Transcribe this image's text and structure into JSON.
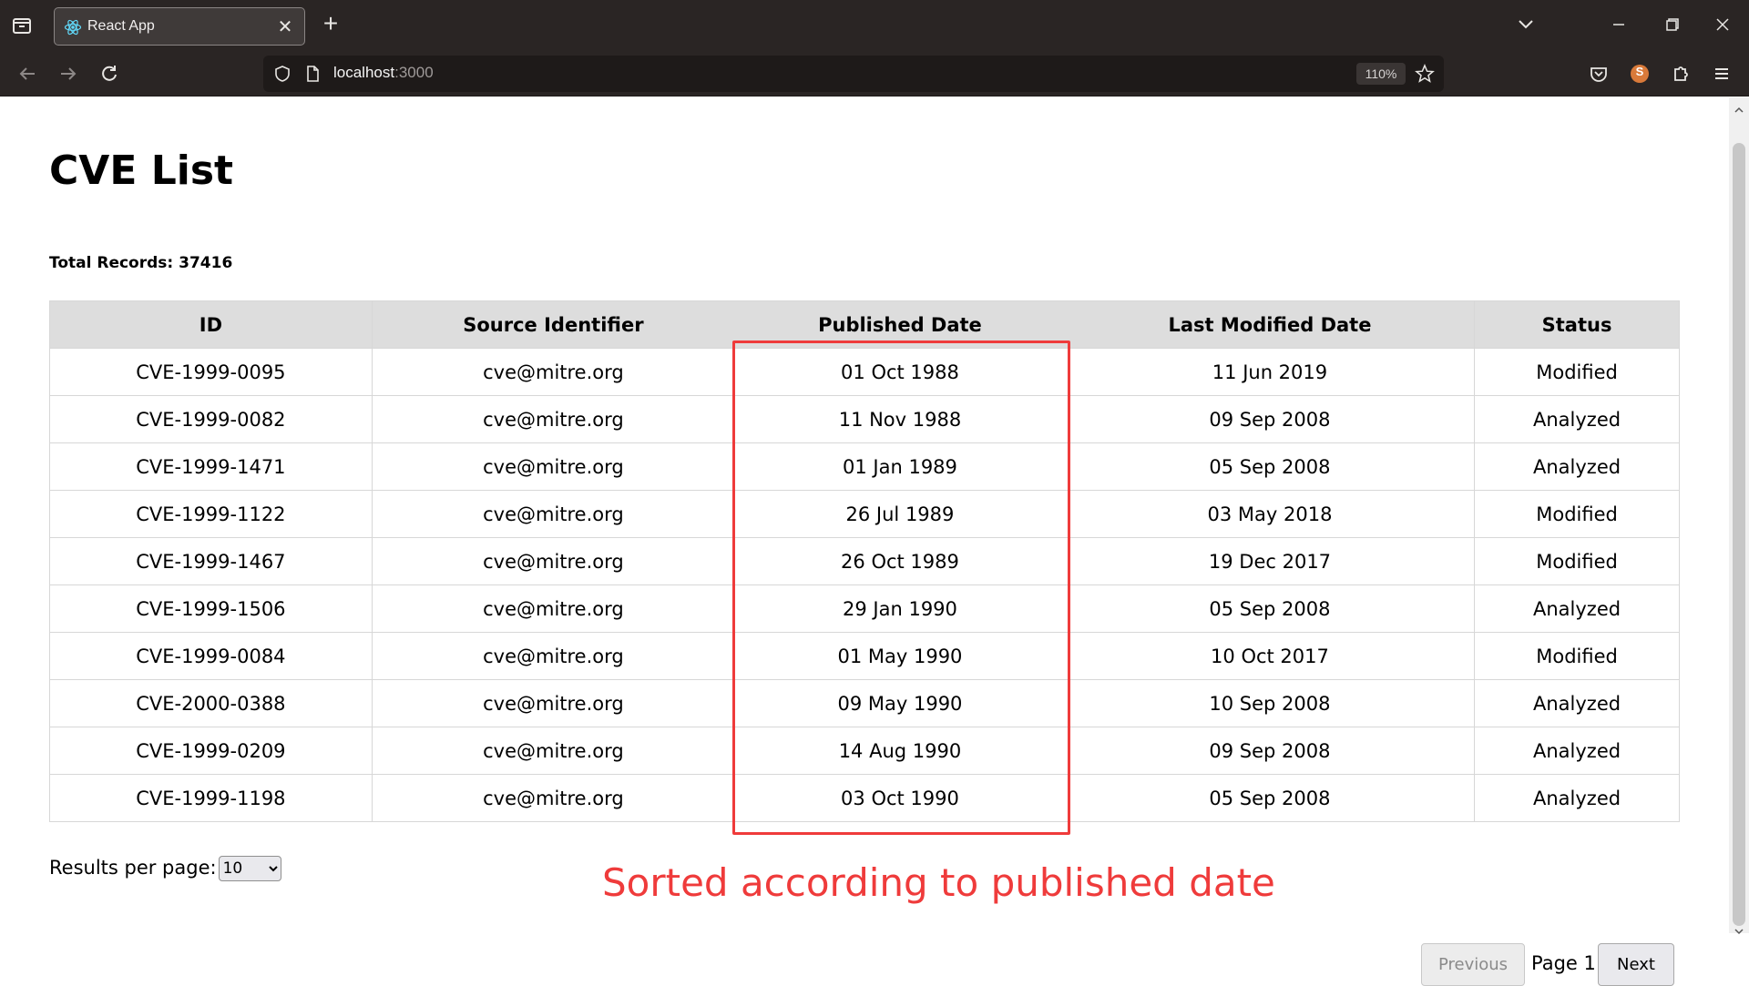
{
  "browser": {
    "tab_title": "React App",
    "url_host": "localhost",
    "url_port": ":3000",
    "zoom": "110%",
    "profile_initial": "S"
  },
  "page": {
    "title": "CVE List",
    "total_records": "Total Records: 37416"
  },
  "table": {
    "headers": [
      "ID",
      "Source Identifier",
      "Published Date",
      "Last Modified Date",
      "Status"
    ],
    "rows": [
      [
        "CVE-1999-0095",
        "cve@mitre.org",
        "01 Oct 1988",
        "11 Jun 2019",
        "Modified"
      ],
      [
        "CVE-1999-0082",
        "cve@mitre.org",
        "11 Nov 1988",
        "09 Sep 2008",
        "Analyzed"
      ],
      [
        "CVE-1999-1471",
        "cve@mitre.org",
        "01 Jan 1989",
        "05 Sep 2008",
        "Analyzed"
      ],
      [
        "CVE-1999-1122",
        "cve@mitre.org",
        "26 Jul 1989",
        "03 May 2018",
        "Modified"
      ],
      [
        "CVE-1999-1467",
        "cve@mitre.org",
        "26 Oct 1989",
        "19 Dec 2017",
        "Modified"
      ],
      [
        "CVE-1999-1506",
        "cve@mitre.org",
        "29 Jan 1990",
        "05 Sep 2008",
        "Analyzed"
      ],
      [
        "CVE-1999-0084",
        "cve@mitre.org",
        "01 May 1990",
        "10 Oct 2017",
        "Modified"
      ],
      [
        "CVE-2000-0388",
        "cve@mitre.org",
        "09 May 1990",
        "10 Sep 2008",
        "Analyzed"
      ],
      [
        "CVE-1999-0209",
        "cve@mitre.org",
        "14 Aug 1990",
        "09 Sep 2008",
        "Analyzed"
      ],
      [
        "CVE-1999-1198",
        "cve@mitre.org",
        "03 Oct 1990",
        "05 Sep 2008",
        "Analyzed"
      ]
    ]
  },
  "pagination": {
    "results_per_page_label": "Results per page:",
    "results_per_page_value": "10",
    "previous_label": "Previous",
    "page_label": "Page 1",
    "next_label": "Next"
  },
  "annotation": {
    "text": "Sorted according to published date",
    "color": "#ef3b3b"
  }
}
